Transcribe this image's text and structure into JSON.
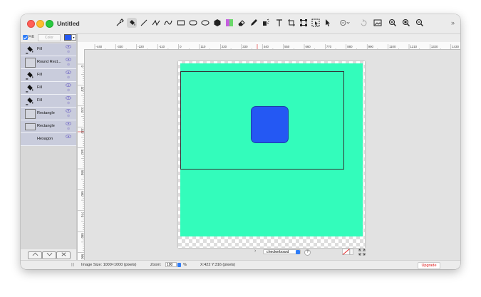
{
  "window": {
    "title": "Untitled"
  },
  "toolbar": {
    "tools": [
      {
        "icon": "eyedropper-icon"
      },
      {
        "icon": "paint-bucket-icon",
        "active": true
      },
      {
        "icon": "line-icon"
      },
      {
        "icon": "zigzag-icon"
      },
      {
        "icon": "curve-icon"
      },
      {
        "icon": "rectangle-icon"
      },
      {
        "icon": "rounded-rectangle-icon"
      },
      {
        "icon": "ellipse-icon"
      },
      {
        "icon": "hexagon-icon"
      },
      {
        "icon": "gradient-icon"
      },
      {
        "icon": "eraser-icon"
      },
      {
        "icon": "pencil-icon"
      },
      {
        "icon": "magic-icon"
      },
      {
        "icon": "text-icon"
      },
      {
        "icon": "crop-icon"
      },
      {
        "icon": "transform-icon"
      },
      {
        "icon": "select-icon"
      },
      {
        "icon": "pointer-icon"
      },
      {
        "icon": "more-icon"
      },
      {
        "icon": "redo-icon"
      },
      {
        "icon": "image-icon"
      },
      {
        "icon": "zoom-in-icon"
      },
      {
        "icon": "zoom-fit-icon"
      },
      {
        "icon": "zoom-out-icon"
      }
    ],
    "overflow": "»"
  },
  "fill": {
    "label": "Fill:",
    "placeholder": "Color",
    "swatch_color": "#2458f3",
    "checked": true
  },
  "layers": [
    {
      "label": "Fill",
      "kind": "fill"
    },
    {
      "label": "Round Rect...",
      "kind": "shape"
    },
    {
      "label": "Fill",
      "kind": "fill"
    },
    {
      "label": "Fill",
      "kind": "fill"
    },
    {
      "label": "Fill",
      "kind": "fill"
    },
    {
      "label": "Rectangle",
      "kind": "shape"
    },
    {
      "label": "Rectangle",
      "kind": "shape"
    },
    {
      "label": "Hexagon",
      "kind": "none"
    }
  ],
  "layer_nav": {
    "up": "^",
    "down": "v",
    "delete": "×"
  },
  "ruler": {
    "h_labels": [
      "-440",
      "-330",
      "-220",
      "-110",
      "0",
      "110",
      "220",
      "330",
      "440",
      "550",
      "660",
      "770",
      "880",
      "990",
      "1100",
      "1210",
      "1320",
      "1430"
    ],
    "v_labels": [
      "0",
      "110",
      "220",
      "330",
      "440",
      "550",
      "660",
      "770",
      "880",
      "990"
    ]
  },
  "canvas": {
    "background_color": "#33fcbb",
    "shape_color": "#2458f3",
    "background_option": "checkerboard",
    "help": "?"
  },
  "status": {
    "image_size": "Image Size: 1000×1000 (pixels)",
    "zoom_label": "Zoom:",
    "zoom_value": "100",
    "zoom_unit": "%",
    "coords": "X:422 Y:316 (pixels)",
    "upgrade": "Upgrade"
  }
}
